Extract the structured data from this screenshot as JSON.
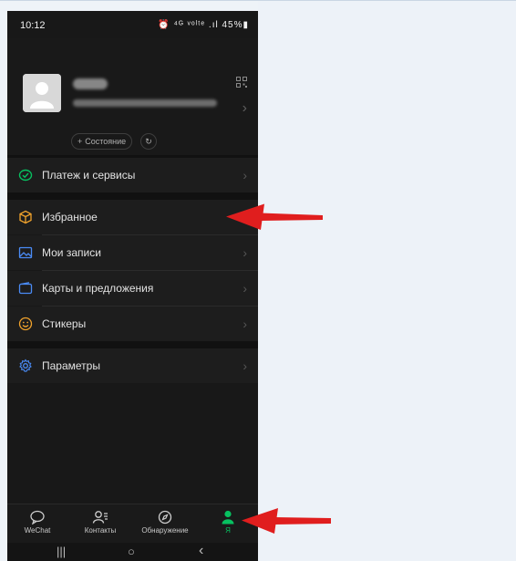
{
  "status_bar": {
    "time": "10:12",
    "indicators": "⏰ ⁴ᴳ ᵛᵒˡᵗᵉ .ıl 45%▮"
  },
  "profile": {
    "status_button": "Состояние",
    "status_plus": "+"
  },
  "menu": {
    "items": [
      {
        "label": "Платеж и сервисы",
        "icon": "payment-icon",
        "color": "#07c160"
      },
      {
        "label": "Избранное",
        "icon": "favorites-cube-icon",
        "color": "#f0a22c"
      },
      {
        "label": "Мои записи",
        "icon": "moments-image-icon",
        "color": "#4a8bf5"
      },
      {
        "label": "Карты и предложения",
        "icon": "cards-wallet-icon",
        "color": "#4a8bf5"
      },
      {
        "label": "Стикеры",
        "icon": "stickers-smiley-icon",
        "color": "#f0a22c"
      },
      {
        "label": "Параметры",
        "icon": "settings-gear-icon",
        "color": "#4a8bf5"
      }
    ]
  },
  "tabbar": {
    "tabs": [
      {
        "label": "WeChat",
        "icon": "chat-bubble-icon",
        "active": false
      },
      {
        "label": "Контакты",
        "icon": "contacts-icon",
        "active": false
      },
      {
        "label": "Обнаружение",
        "icon": "discover-compass-icon",
        "active": false
      },
      {
        "label": "Я",
        "icon": "me-person-icon",
        "active": true
      }
    ]
  },
  "navbar": {
    "recents": "|||",
    "home": "○",
    "back": "‹"
  },
  "colors": {
    "accent_green": "#07c160",
    "annotation_arrow": "#e01e1e",
    "phone_bg": "#181818",
    "page_bg": "#eef3f8"
  }
}
